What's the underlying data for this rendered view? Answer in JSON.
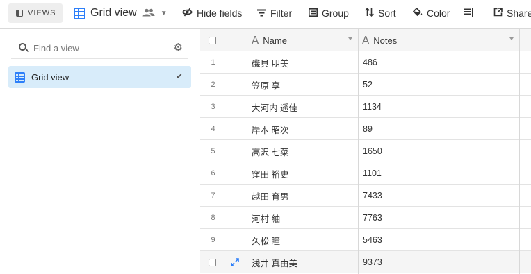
{
  "toolbar": {
    "views_label": "VIEWS",
    "current_view": "Grid view",
    "hide_fields": "Hide fields",
    "filter": "Filter",
    "group": "Group",
    "sort": "Sort",
    "color": "Color",
    "share": "Share"
  },
  "sidebar": {
    "search_placeholder": "Find a view",
    "views": [
      {
        "name": "Grid view",
        "selected": true
      }
    ]
  },
  "grid": {
    "columns": [
      "Name",
      "Notes"
    ],
    "rows": [
      {
        "num": "1",
        "name": "磯貝 朋美",
        "notes": "486"
      },
      {
        "num": "2",
        "name": "笠原 享",
        "notes": "52"
      },
      {
        "num": "3",
        "name": "大河内 遥佳",
        "notes": "1134"
      },
      {
        "num": "4",
        "name": "岸本 昭次",
        "notes": "89"
      },
      {
        "num": "5",
        "name": "高沢 七菜",
        "notes": "1650"
      },
      {
        "num": "6",
        "name": "窪田 裕史",
        "notes": "1101"
      },
      {
        "num": "7",
        "name": "越田 育男",
        "notes": "7433"
      },
      {
        "num": "8",
        "name": "河村 紬",
        "notes": "7763"
      },
      {
        "num": "9",
        "name": "久松 瞳",
        "notes": "5463"
      },
      {
        "num": "",
        "name": "浅井 真由美",
        "notes": "9373"
      }
    ]
  },
  "colors": {
    "accent": "#2d7ff9",
    "selected_view_bg": "#d8ecfa",
    "header_bg": "#f5f5f5"
  }
}
